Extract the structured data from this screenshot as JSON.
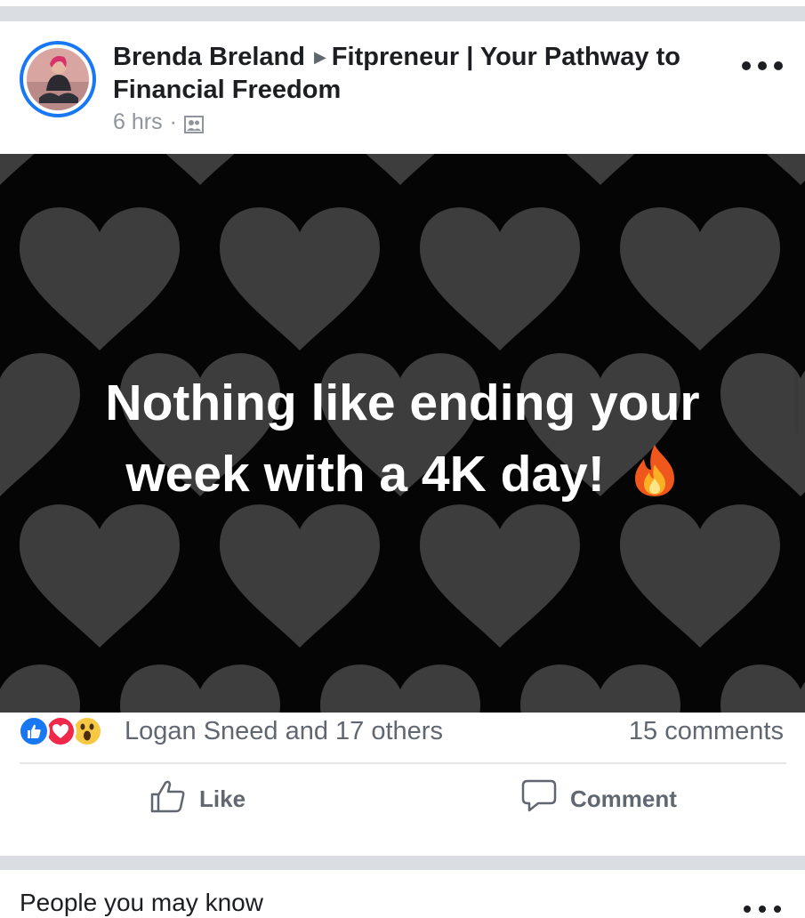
{
  "post": {
    "author": "Brenda Breland",
    "group": "Fitpreneur | Your Pathway to Financial Freedom",
    "time": "6 hrs",
    "separator": "·",
    "privacy_icon": "group-members-icon",
    "more_icon": "more-options-icon",
    "status_text_line1": "Nothing like ending your",
    "status_text_line2": "week with a 4K day!",
    "status_emoji": "fire",
    "background_style": "dark hearts pattern"
  },
  "reactions": {
    "types": [
      "like",
      "love",
      "wow"
    ],
    "summary": "Logan Sneed and 17 others",
    "comments": "15 comments"
  },
  "actions": {
    "like_label": "Like",
    "comment_label": "Comment"
  },
  "next_card": {
    "title": "People you may know"
  },
  "colors": {
    "brand_blue": "#1877f2",
    "love_red": "#f0284a",
    "wow_yellow": "#f7c844",
    "separator_gray": "#dadde1",
    "secondary_text": "#606770",
    "heart_gray": "#3f3f3f"
  }
}
